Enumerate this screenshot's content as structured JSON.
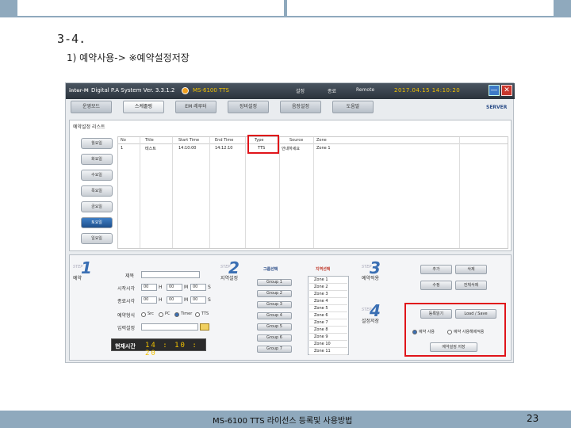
{
  "slide": {
    "heading": "3-4.",
    "subheading": "1) 예약사용-> ※예약설정저장",
    "footer_text": "MS-6100 TTS 라이선스 등록및 사용방법",
    "page_number": "23"
  },
  "app": {
    "title_logo": "inter-M",
    "system_title": "Digital P.A System Ver. 3.3.1.2",
    "model": "MS-6100 TTS",
    "title_icons": [
      "설정",
      "종료",
      "Remote"
    ],
    "datetime": "2017.04.15 14:10:20",
    "minimize_label": "—",
    "close_label": "✕",
    "server_label": "SERVER",
    "tabs": [
      "운영모드",
      "스케줄링",
      "EM 레루터",
      "장비설정",
      "음장설정",
      "도움말"
    ],
    "active_tab": 1
  },
  "schedule_list": {
    "title": "예약설정 리스트",
    "days": [
      "월요일",
      "화요일",
      "수요일",
      "목요일",
      "금요일",
      "토요일",
      "일요일"
    ],
    "active_day": 5,
    "columns": [
      "No",
      "Title",
      "Start Time",
      "End Time",
      "Type",
      "Source",
      "Zone"
    ],
    "rows": [
      [
        "1",
        "테스트",
        "14:10:00",
        "14:12:10",
        "TTS",
        "안내하세요",
        "Zone 1"
      ]
    ]
  },
  "step1": {
    "word": "STEP",
    "number": "1",
    "label": "예약",
    "fields": {
      "title_label": "제목",
      "start_label": "시작시각",
      "end_label": "종료시각",
      "method_label": "예약형식",
      "input_label": "입력설정",
      "h": "H",
      "m": "M",
      "s": "S",
      "sel_val": "00"
    },
    "methods": [
      "Src",
      "PC",
      "Timer",
      "TTS"
    ],
    "method_selected": 2,
    "clock_label": "현재시간",
    "clock_time": "14 : 10 : 20"
  },
  "step2": {
    "word": "STEP",
    "number": "2",
    "label": "지역설정",
    "group_header": "그룹선택",
    "zone_header": "지역선택",
    "groups": [
      "Group 1",
      "Group 2",
      "Group 3",
      "Group 4",
      "Group 5",
      "Group 6",
      "Group 7"
    ],
    "zones": [
      "Zone 1",
      "Zone 2",
      "Zone 3",
      "Zone 4",
      "Zone 5",
      "Zone 6",
      "Zone 7",
      "Zone 8",
      "Zone 9",
      "Zone 10",
      "Zone 11"
    ]
  },
  "step3": {
    "word": "STEP",
    "number": "3",
    "label": "예약적용",
    "buttons": [
      "추가",
      "삭제",
      "수정",
      "전체삭제"
    ]
  },
  "step4": {
    "word": "STEP",
    "number": "4",
    "label": "설정저장",
    "buttons": [
      "등록읽기",
      "Load / Save"
    ],
    "radio1": "예약 사용",
    "radio2": "예약 사용해제적용",
    "save_button": "예약설정 저장"
  },
  "colors": {
    "highlight": "#e0141a",
    "accent_blue": "#3a6fb3",
    "slide_bar": "#8fa9bd"
  }
}
